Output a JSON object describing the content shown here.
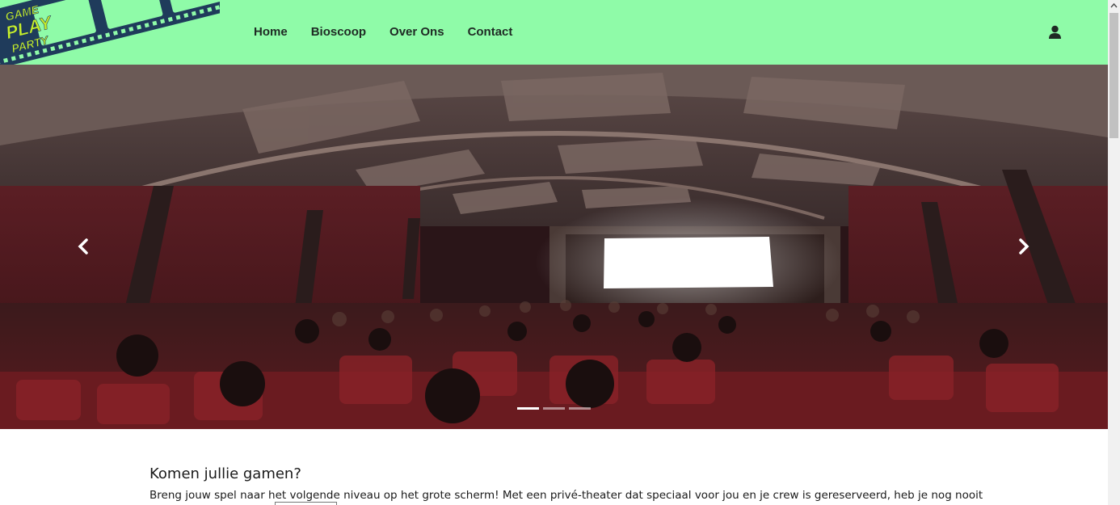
{
  "logo": {
    "name": "logo",
    "lines": [
      "GAME",
      "PLAY",
      "PARTY"
    ]
  },
  "nav": {
    "items": [
      {
        "label": "Home"
      },
      {
        "label": "Bioscoop"
      },
      {
        "label": "Over Ons"
      },
      {
        "label": "Contact"
      }
    ]
  },
  "header": {
    "user_icon": "user-icon",
    "bg_color": "#8ffba8"
  },
  "carousel": {
    "prev_icon": "chevron-left-icon",
    "next_icon": "chevron-right-icon",
    "slide_count": 3,
    "active_index": 0
  },
  "content": {
    "heading": "Komen jullie gamen?",
    "text": "Breng jouw spel naar het volgende niveau op het grote scherm! Met een privé-theater dat speciaal voor jou en je crew is gereserveerd, heb je nog nooit"
  }
}
